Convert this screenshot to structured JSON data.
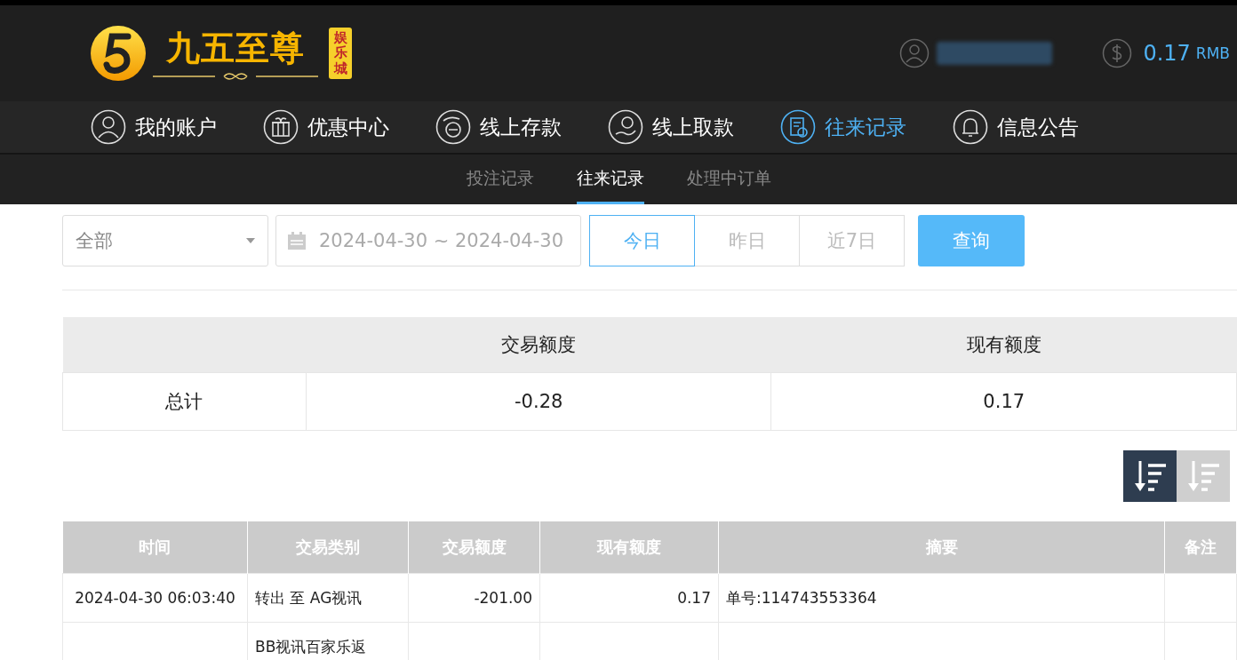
{
  "header": {
    "logo_title": "九五至尊",
    "logo_badge": "娱乐城",
    "balance": "0.17",
    "currency": "RMB"
  },
  "nav": [
    {
      "label": "我的账户",
      "selected": false
    },
    {
      "label": "优惠中心",
      "selected": false
    },
    {
      "label": "线上存款",
      "selected": false
    },
    {
      "label": "线上取款",
      "selected": false
    },
    {
      "label": "往来记录",
      "selected": true
    },
    {
      "label": "信息公告",
      "selected": false
    }
  ],
  "subtabs": [
    {
      "label": "投注记录",
      "selected": false
    },
    {
      "label": "往来记录",
      "selected": true
    },
    {
      "label": "处理中订单",
      "selected": false
    }
  ],
  "filters": {
    "type_select": "全部",
    "date_range": "2024-04-30 ~ 2024-04-30",
    "quick_ranges": [
      {
        "label": "今日",
        "selected": true
      },
      {
        "label": "昨日",
        "selected": false
      },
      {
        "label": "近7日",
        "selected": false
      }
    ],
    "query_button": "查询"
  },
  "summary": {
    "columns": [
      "",
      "交易额度",
      "现有额度"
    ],
    "rows": [
      [
        "总计",
        "-0.28",
        "0.17"
      ]
    ]
  },
  "sort_buttons": [
    {
      "selected": true
    },
    {
      "selected": false
    }
  ],
  "table": {
    "columns": [
      "时间",
      "交易类别",
      "交易额度",
      "现有额度",
      "摘要",
      "备注"
    ],
    "rows": [
      [
        "2024-04-30 06:03:40",
        "转出 至 AG视讯",
        "-201.00",
        "0.17",
        "单号:114743553364",
        ""
      ],
      [
        "",
        "BB视讯百家乐返",
        "",
        "",
        "",
        ""
      ]
    ]
  }
}
